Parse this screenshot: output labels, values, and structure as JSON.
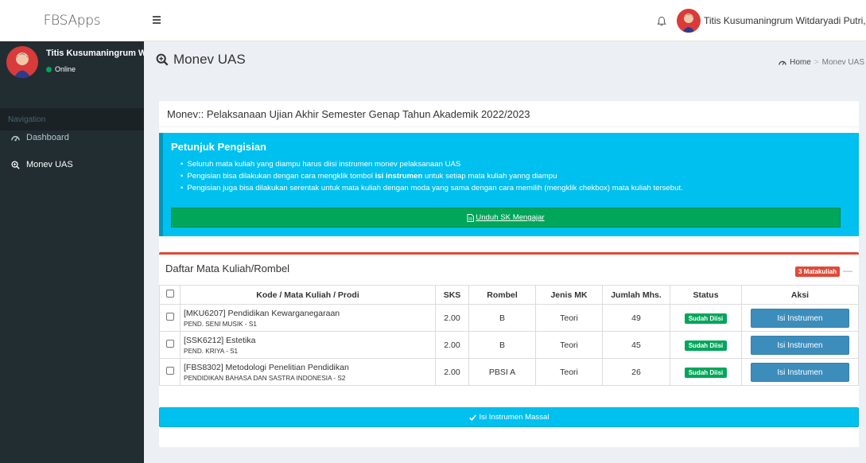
{
  "app": {
    "brand": "FBSApps"
  },
  "header": {
    "user_name": "Titis Kusumaningrum Witdaryadi Putri, M.Pd."
  },
  "sidebar": {
    "user_name": "Titis Kusumaningrum Witdaryadi Putri, M.Pd.",
    "status": "Online",
    "nav_header": "Navigation",
    "items": [
      {
        "label": "Dashboard",
        "icon": "dashboard-icon"
      },
      {
        "label": "Monev UAS",
        "icon": "search-plus-icon"
      }
    ]
  },
  "page": {
    "title": "Monev UAS",
    "breadcrumb": {
      "home": "Home",
      "separator": ">",
      "current": "Monev UAS"
    }
  },
  "box": {
    "title": "Monev:: Pelaksanaan Ujian Akhir Semester Genap Tahun Akademik 2022/2023"
  },
  "callout": {
    "title": "Petunjuk Pengisian",
    "items": [
      "Seluruh mata kuliah yang diampu harus diisi instrumen monev pelaksanaan UAS",
      {
        "before": "Pengisian bisa dilakukan dengan cara mengklik tombol ",
        "bold": "isi instrumen",
        "after": " untuk setiap mata kuliah yanng diampu"
      },
      "Pengisian juga bisa dilakukan serentak untuk mata kuliah dengan moda yang sama dengan cara memilih (mengklik chekbox) mata kuliah tersebut."
    ],
    "download_label": "Unduh SK Mengajar"
  },
  "table_box": {
    "title": "Daftar Mata Kuliah/Rombel",
    "badge": "3 Matakuliah",
    "collapse_label": "—",
    "columns": [
      "Kode / Mata Kuliah / Prodi",
      "SKS",
      "Rombel",
      "Jenis MK",
      "Jumlah Mhs.",
      "Status",
      "Aksi"
    ],
    "rows": [
      {
        "name": "[MKU6207] Pendidikan Kewarganegaraan",
        "prodi": "PEND. SENI MUSIK - S1",
        "sks": "2.00",
        "rombel": "B",
        "jenis": "Teori",
        "jumlah": "49",
        "status": "Sudah Diisi",
        "action": "Isi Instrumen"
      },
      {
        "name": "[SSK6212] Estetika",
        "prodi": "PEND. KRIYA - S1",
        "sks": "2.00",
        "rombel": "B",
        "jenis": "Teori",
        "jumlah": "45",
        "status": "Sudah Diisi",
        "action": "Isi Instrumen"
      },
      {
        "name": "[FBS8302] Metodologi Penelitian Pendidikan",
        "prodi": "PENDIDIKAN BAHASA DAN SASTRA INDONESIA - S2",
        "sks": "2.00",
        "rombel": "PBSI A",
        "jenis": "Teori",
        "jumlah": "26",
        "status": "Sudah Diisi",
        "action": "Isi Instrumen"
      }
    ]
  },
  "massal_button": "Isi Instrumen Massal",
  "colors": {
    "sidebar": "#222d32",
    "info": "#00c0ef",
    "success": "#00a65a",
    "primary": "#3c8dbc",
    "danger": "#dd4b39"
  }
}
